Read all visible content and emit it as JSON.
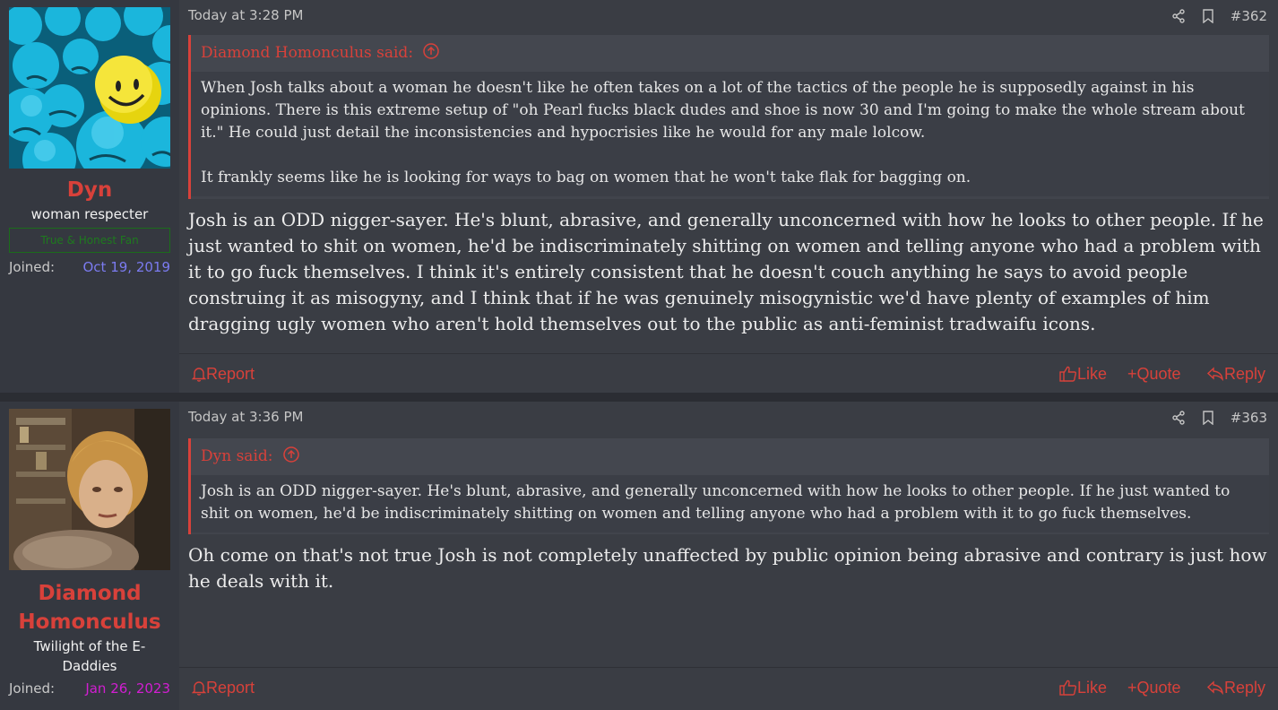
{
  "posts": [
    {
      "username": "Dyn",
      "user_title": "woman respecter",
      "banner": "True & Honest Fan",
      "joined_label": "Joined:",
      "joined_date": "Oct 19, 2019",
      "joined_color": "#7b7bf0",
      "avatar_icon": "smiley-balls-avatar",
      "timestamp": "Today at 3:28 PM",
      "post_number": "#362",
      "quote": {
        "author": "Diamond Homonculus said:",
        "paragraphs": [
          "When Josh talks about a woman he doesn't like he often takes on a lot of the tactics of the people he is supposedly against in his opinions. There is this extreme setup of \"oh Pearl fucks black dudes and shoe is now 30 and I'm going to make the whole stream about it.\" He could just detail the inconsistencies and hypocrisies like he would for any male lolcow.",
          "It frankly seems like he is looking for ways to bag on women that he won't take flak for bagging on."
        ]
      },
      "body": "Josh is an ODD nigger-sayer. He's blunt, abrasive, and generally unconcerned with how he looks to other people. If he just wanted to shit on women, he'd be indiscriminately shitting on women and telling anyone who had a problem with it to go fuck themselves. I think it's entirely consistent that he doesn't couch anything he says to avoid people construing it as misogyny, and I think that if he was genuinely misogynistic we'd have plenty of examples of him dragging ugly women who aren't hold themselves out to the public as anti-feminist tradwaifu icons."
    },
    {
      "username": "Diamond Homonculus",
      "user_title": "Twilight of the E-Daddies",
      "joined_label": "Joined:",
      "joined_date": "Jan 26, 2023",
      "joined_color": "#d21ed2",
      "avatar_icon": "woman-photo-avatar",
      "timestamp": "Today at 3:36 PM",
      "post_number": "#363",
      "quote": {
        "author": "Dyn said:",
        "paragraphs": [
          "Josh is an ODD nigger-sayer. He's blunt, abrasive, and generally unconcerned with how he looks to other people. If he just wanted to shit on women, he'd be indiscriminately shitting on women and telling anyone who had a problem with it to go fuck themselves."
        ]
      },
      "body": "Oh come on that's not true Josh is not completely unaffected by public opinion being abrasive and contrary is just how he deals with it."
    }
  ],
  "actions": {
    "report": "Report",
    "like": "Like",
    "quote": "Quote",
    "reply": "Reply"
  },
  "colors": {
    "accent": "#d8413a",
    "background": "#3a3d44",
    "sidebar": "#353840"
  }
}
